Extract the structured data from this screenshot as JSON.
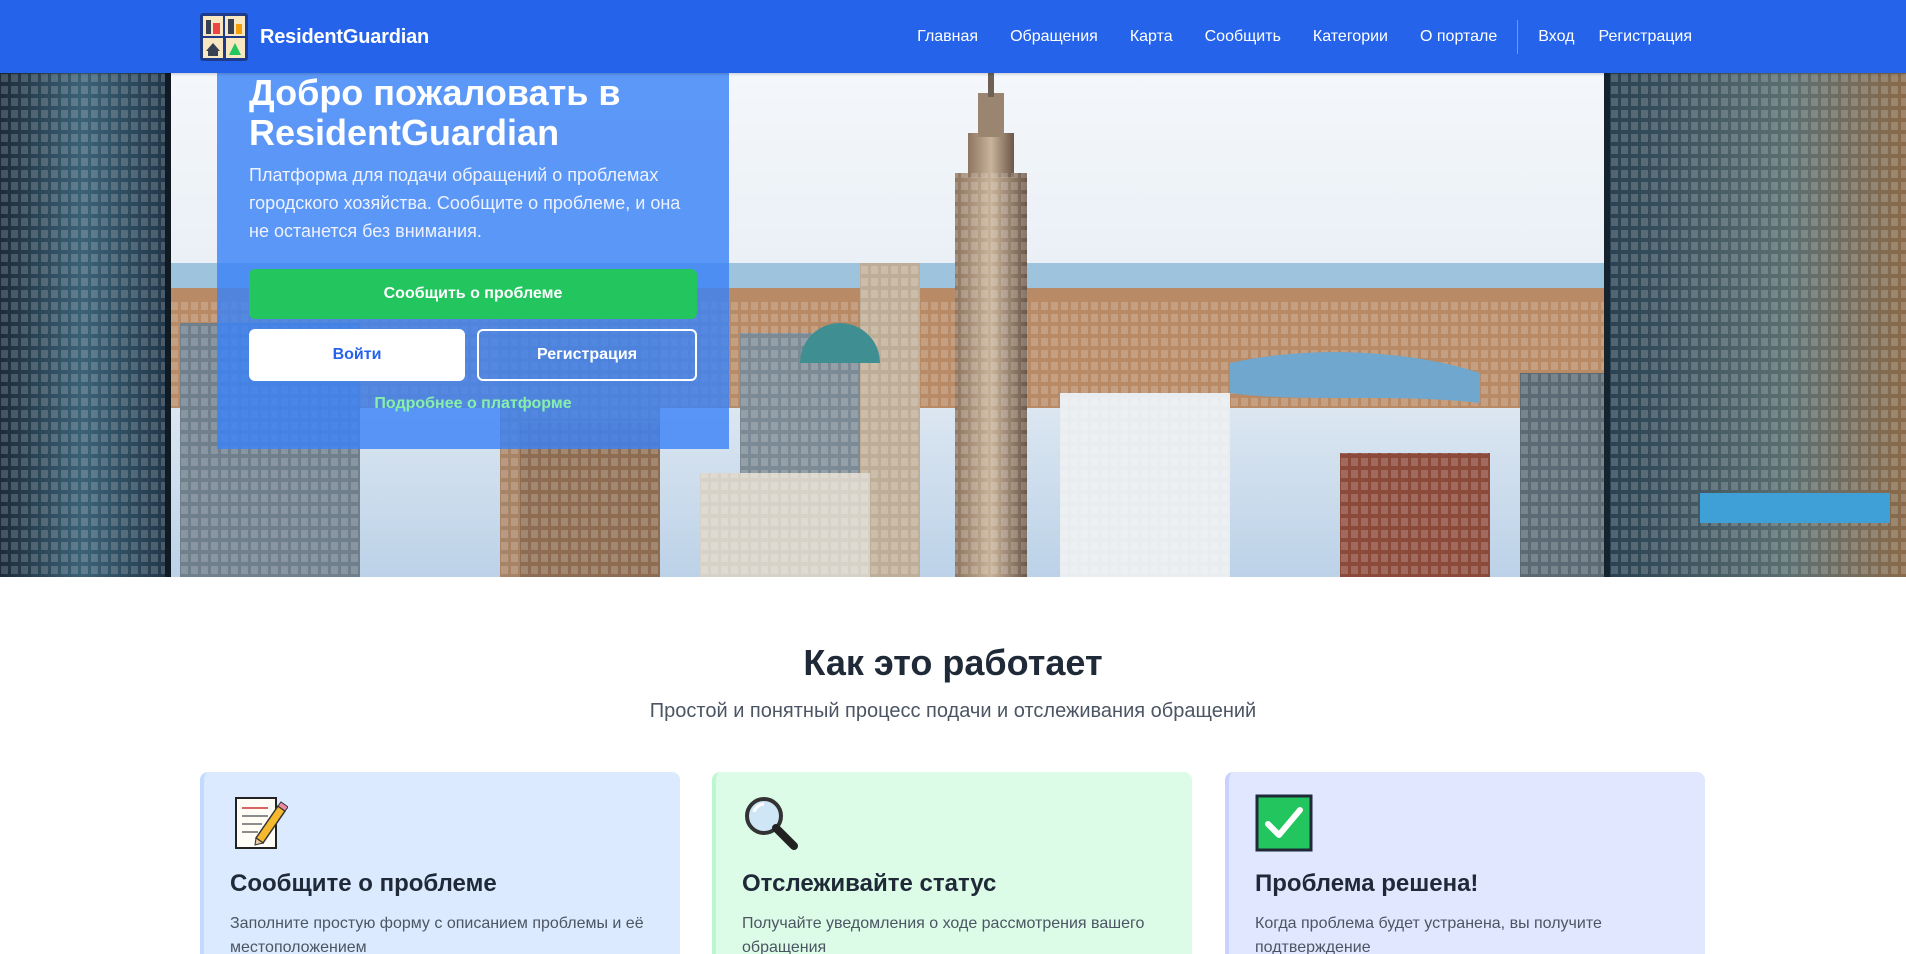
{
  "navbar": {
    "brand": "ResidentGuardian",
    "links": [
      "Главная",
      "Обращения",
      "Карта",
      "Сообщить",
      "Категории",
      "О портале"
    ],
    "auth": [
      "Вход",
      "Регистрация"
    ]
  },
  "hero": {
    "title": "Добро пожаловать в ResidentGuardian",
    "description": "Платформа для подачи обращений о проблемах городского хозяйства. Сообщите о проблеме, и она не останется без внимания.",
    "report_button": "Сообщить о проблеме",
    "login_button": "Войти",
    "register_button": "Регистрация",
    "more_link": "Подробнее о платформе"
  },
  "how": {
    "title": "Как это работает",
    "subtitle": "Простой и понятный процесс подачи и отслеживания обращений",
    "cards": [
      {
        "icon": "memo-pencil-icon",
        "title": "Сообщите о проблеме",
        "text": "Заполните простую форму с описанием проблемы и её местоположением"
      },
      {
        "icon": "magnifier-icon",
        "title": "Отслеживайте статус",
        "text": "Получайте уведомления о ходе рассмотрения вашего обращения"
      },
      {
        "icon": "checkmark-icon",
        "title": "Проблема решена!",
        "text": "Когда проблема будет устранена, вы получите подтверждение"
      }
    ]
  },
  "colors": {
    "primary": "#2563eb",
    "success": "#22c55e",
    "link_green": "#86efac"
  }
}
